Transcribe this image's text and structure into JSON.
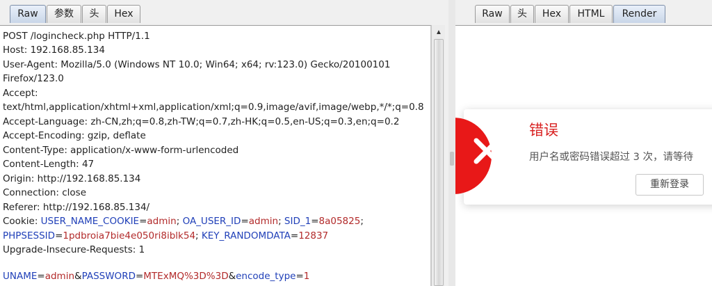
{
  "left_tabs": [
    "Raw",
    "参数",
    "头",
    "Hex"
  ],
  "right_tabs": [
    "Raw",
    "头",
    "Hex",
    "HTML",
    "Render"
  ],
  "request": {
    "lines": [
      "POST /logincheck.php HTTP/1.1",
      "Host: 192.168.85.134",
      "User-Agent: Mozilla/5.0 (Windows NT 10.0; Win64; x64; rv:123.0) Gecko/20100101",
      "Firefox/123.0",
      "Accept:",
      "text/html,application/xhtml+xml,application/xml;q=0.9,image/avif,image/webp,*/*;q=0.8",
      "Accept-Language: zh-CN,zh;q=0.8,zh-TW;q=0.7,zh-HK;q=0.5,en-US;q=0.3,en;q=0.2",
      "Accept-Encoding: gzip, deflate",
      "Content-Type: application/x-www-form-urlencoded",
      "Content-Length: 47",
      "Origin: http://192.168.85.134",
      "Connection: close",
      "Referer: http://192.168.85.134/"
    ],
    "cookie_label": "Cookie: ",
    "cookies": [
      {
        "key": "USER_NAME_COOKIE",
        "value": "admin"
      },
      {
        "key": "OA_USER_ID",
        "value": "admin"
      },
      {
        "key": "SID_1",
        "value": "8a05825"
      },
      {
        "key": "PHPSESSID",
        "value": "1pdbroia7bie4e050ri8iblk54"
      },
      {
        "key": "KEY_RANDOMDATA",
        "value": "12837"
      }
    ],
    "upgrade_line": "Upgrade-Insecure-Requests: 1",
    "body_params": [
      {
        "key": "UNAME",
        "value": "admin"
      },
      {
        "key": "PASSWORD",
        "value": "MTExMQ%3D%3D"
      },
      {
        "key": "encode_type",
        "value": "1"
      }
    ]
  },
  "render": {
    "error_title": "错误",
    "error_message": "用户名或密码错误超过 3 次，请等待",
    "relogin_button": "重新登录"
  },
  "colors": {
    "param_key": "#1f3fb8",
    "param_value": "#b22a2a",
    "error_red": "#e81818"
  }
}
